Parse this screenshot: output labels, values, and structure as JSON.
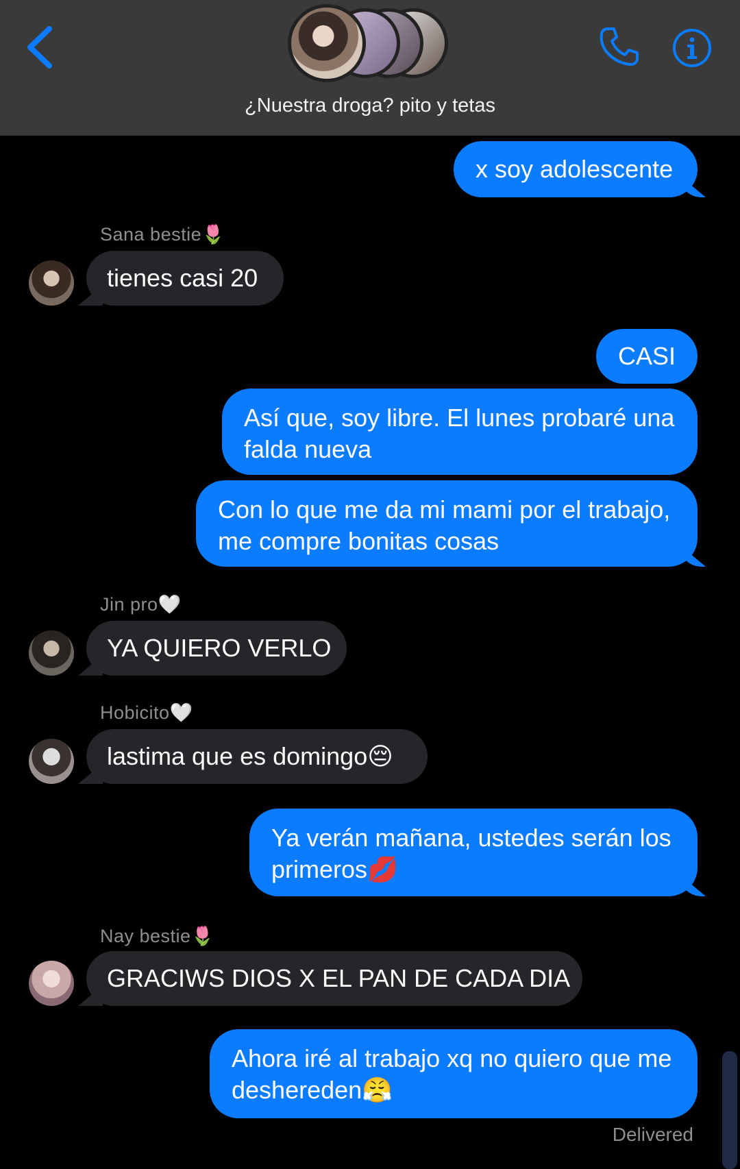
{
  "header": {
    "group_name": "¿Nuestra droga? pito y tetas",
    "back_icon": "chevron-left-icon",
    "phone_icon": "phone-icon",
    "info_icon": "info-icon",
    "accent_color": "#0b7cff"
  },
  "messages": [
    {
      "type": "sent",
      "text": "x soy adolescente"
    },
    {
      "type": "received",
      "sender": "Sana bestie🌷",
      "text": "tienes casi 20"
    },
    {
      "type": "sent",
      "text": "CASI"
    },
    {
      "type": "sent",
      "lines": [
        "Así que, soy libre. El lunes probaré una",
        "falda nueva"
      ]
    },
    {
      "type": "sent",
      "lines": [
        "Con lo que me da mi mami por el trabajo,",
        "me compre bonitas cosas"
      ]
    },
    {
      "type": "received",
      "sender": "Jin pro🤍",
      "text": "YA QUIERO VERLO"
    },
    {
      "type": "received",
      "sender": "Hobicito🤍",
      "text": "lastima que es domingo😔"
    },
    {
      "type": "sent",
      "lines": [
        "Ya verán mañana, ustedes serán los",
        "primeros💋"
      ]
    },
    {
      "type": "received",
      "sender": "Nay bestie🌷",
      "text": "GRACIWS DIOS X EL PAN DE CADA DIA"
    },
    {
      "type": "sent",
      "lines": [
        "Ahora iré al trabajo xq no quiero que me",
        "deshereden😤"
      ]
    }
  ],
  "status": "Delivered",
  "colors": {
    "sent_bubble": "#0b7cff",
    "received_bubble": "#26252a",
    "header_bg": "#3a3a3a",
    "sender_label": "#8e8e93"
  }
}
